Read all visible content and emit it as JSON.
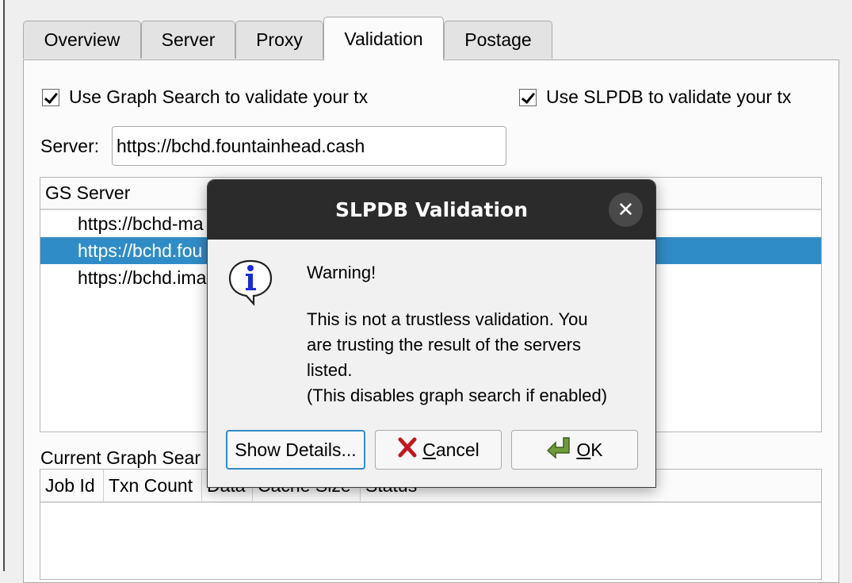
{
  "tabs": [
    {
      "label": "Overview"
    },
    {
      "label": "Server"
    },
    {
      "label": "Proxy"
    },
    {
      "label": "Validation"
    },
    {
      "label": "Postage"
    }
  ],
  "validation": {
    "graph_search_check": "Use Graph Search to validate your tx",
    "slpdb_check": "Use SLPDB to validate your tx",
    "server_label": "Server:",
    "server_value": "https://bchd.fountainhead.cash",
    "list_header": "GS Server",
    "servers": [
      {
        "text": "https://bchd-ma"
      },
      {
        "text": "https://bchd.fou"
      },
      {
        "text": "https://bchd.ima"
      }
    ],
    "jobs_label": "Current Graph Sear",
    "jobs_columns": [
      "Job Id",
      "Txn Count",
      "Data",
      "Cache Size",
      "Status"
    ]
  },
  "dialog": {
    "title": "SLPDB Validation",
    "close_glyph": "✕",
    "icon": "info-icon",
    "heading": "Warning!",
    "body_lines": [
      "This is not a trustless validation. You",
      "are trusting the result of the servers",
      "listed.",
      "(This disables graph search if enabled)"
    ],
    "show_details": "Show Details...",
    "cancel_mnemonic": "C",
    "cancel_rest": "ancel",
    "ok_mnemonic": "O",
    "ok_rest": "K"
  },
  "colors": {
    "selection": "#308cc6",
    "titlebar": "#2b2b2b"
  }
}
